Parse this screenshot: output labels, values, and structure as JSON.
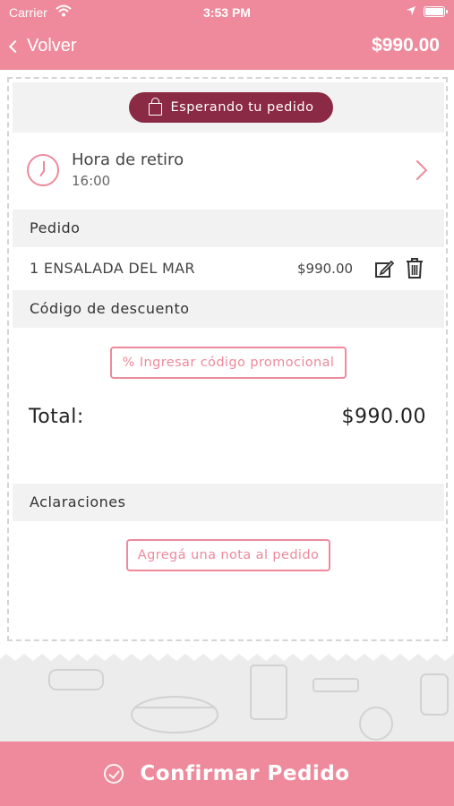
{
  "status_bar": {
    "carrier": "Carrier",
    "time": "3:53 PM"
  },
  "nav": {
    "back_label": "Volver",
    "total": "$990.00"
  },
  "order_status": {
    "label": "Esperando tu pedido"
  },
  "pickup": {
    "title": "Hora de retiro",
    "time": "16:00"
  },
  "order": {
    "header": "Pedido",
    "items": [
      {
        "name": "1 ENSALADA DEL MAR",
        "price": "$990.00"
      }
    ]
  },
  "discount": {
    "header": "Código de descuento",
    "button_label": "% Ingresar código promocional"
  },
  "total": {
    "label": "Total:",
    "value": "$990.00"
  },
  "notes": {
    "header": "Aclaraciones",
    "button_label": "Agregá una nota al pedido"
  },
  "confirm": {
    "label": "Confirmar Pedido"
  },
  "colors": {
    "accent": "#ee8a9c",
    "status_pill": "#8b2a44",
    "section_bg": "#f2f2f2"
  }
}
